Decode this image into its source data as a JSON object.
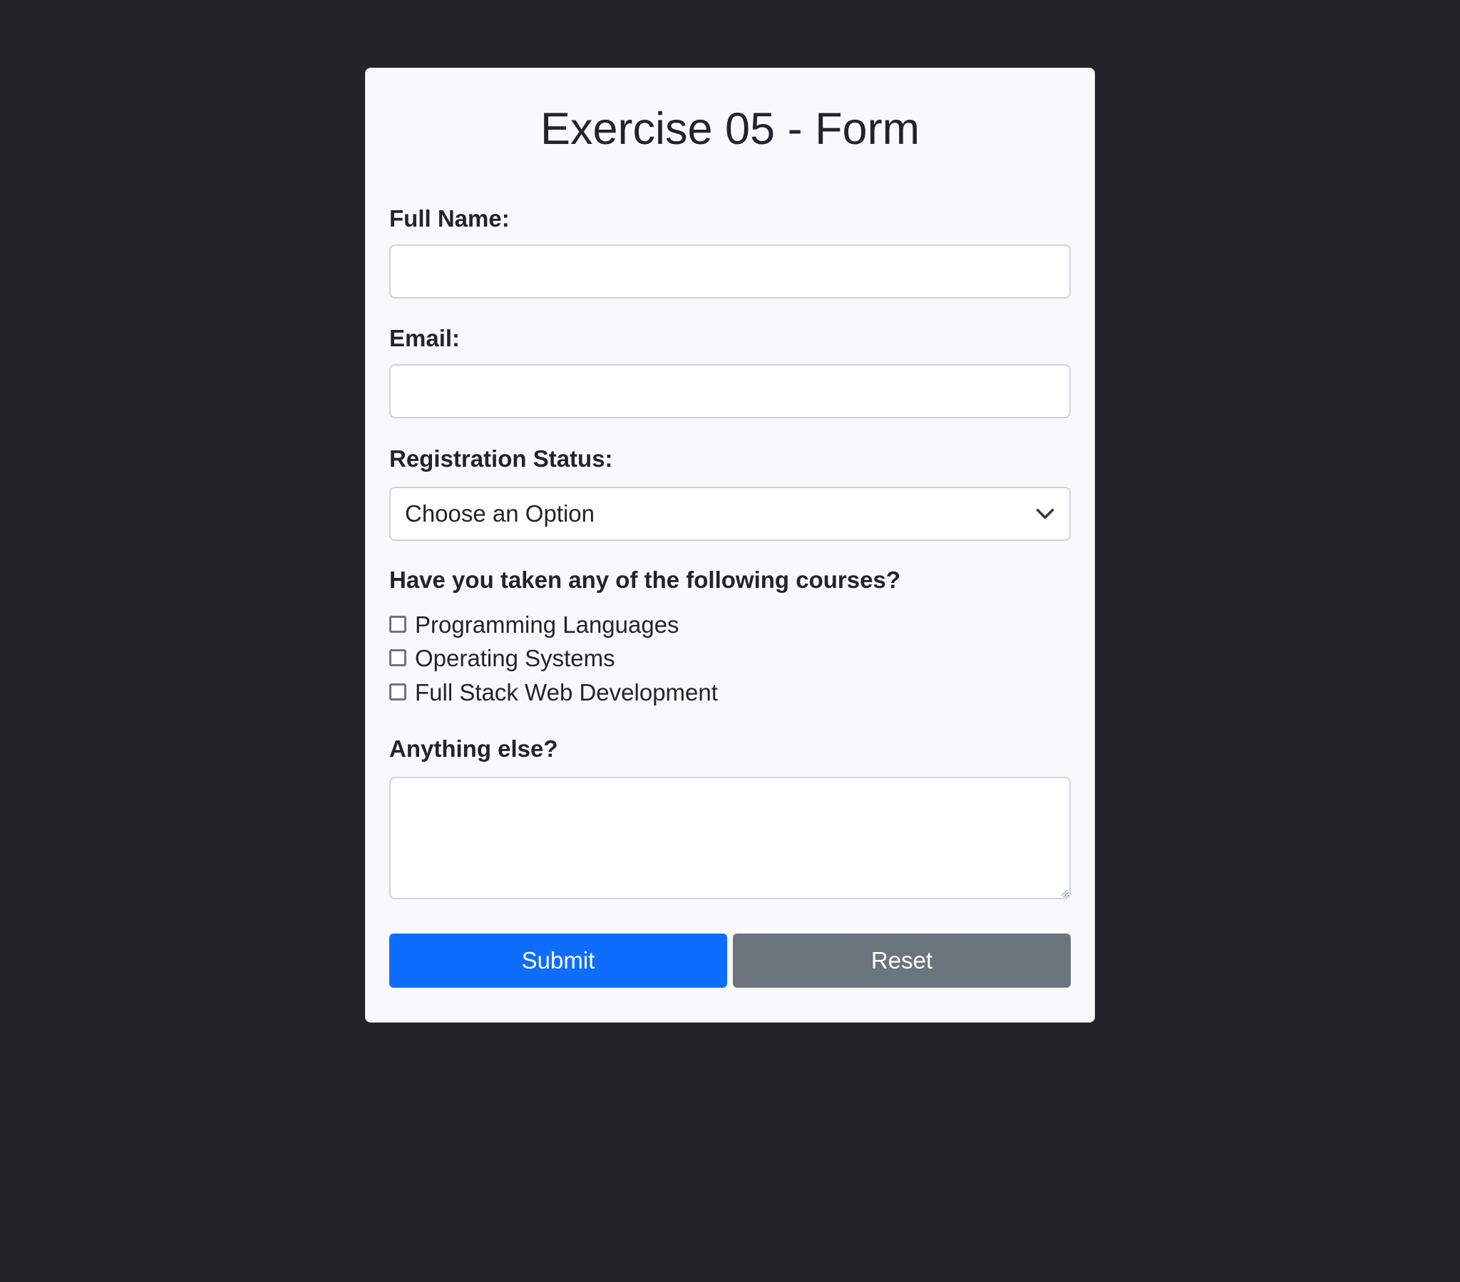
{
  "form": {
    "title": "Exercise 05 - Form",
    "full_name": {
      "label": "Full Name:",
      "value": "",
      "placeholder": ""
    },
    "email": {
      "label": "Email:",
      "value": "",
      "placeholder": ""
    },
    "registration_status": {
      "label": "Registration Status:",
      "selected": "Choose an Option"
    },
    "courses": {
      "question": "Have you taken any of the following courses?",
      "options": [
        {
          "label": "Programming Languages",
          "checked": false
        },
        {
          "label": "Operating Systems",
          "checked": false
        },
        {
          "label": "Full Stack Web Development",
          "checked": false
        }
      ]
    },
    "anything_else": {
      "label": "Anything else?",
      "value": ""
    },
    "buttons": {
      "submit_label": "Submit",
      "reset_label": "Reset"
    }
  },
  "colors": {
    "page_background": "#212529",
    "card_background": "#f8f9fa",
    "submit_button": "#0d6efd",
    "reset_button": "#6c757d"
  },
  "icons": {
    "select_indicator": "chevron-down-icon",
    "textarea_resize": "resize-grip-icon"
  }
}
